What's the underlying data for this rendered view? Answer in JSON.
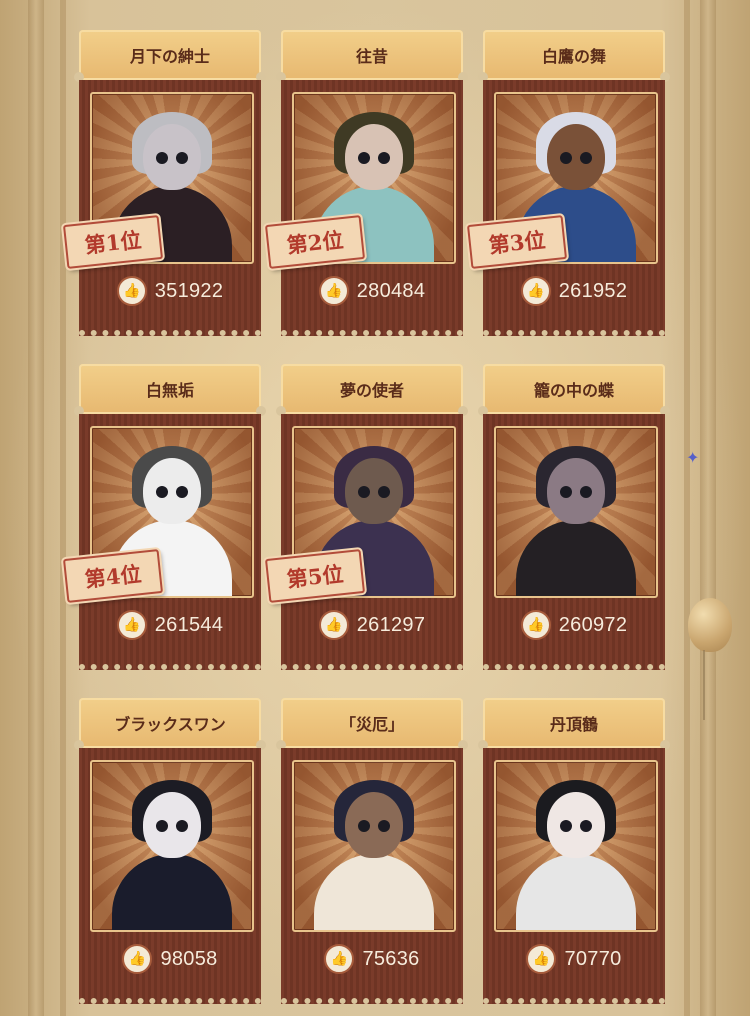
{
  "cards": [
    {
      "name": "月下の紳士",
      "likes": "351922",
      "rank": "第1位",
      "palette": {
        "skin": "#c8c2c8",
        "hair": "#bdbdc2",
        "outfit": "#2b1f24",
        "accent": "#8b1e24"
      }
    },
    {
      "name": "往昔",
      "likes": "280484",
      "rank": "第2位",
      "palette": {
        "skin": "#d8c2b4",
        "hair": "#3f3a24",
        "outfit": "#8dc2c0",
        "accent": "#f2efe6"
      }
    },
    {
      "name": "白鷹の舞",
      "likes": "261952",
      "rank": "第3位",
      "palette": {
        "skin": "#7a5138",
        "hair": "#d9dbe6",
        "outfit": "#2d4d8a",
        "accent": "#f0f0f4"
      }
    },
    {
      "name": "白無垢",
      "likes": "261544",
      "rank": "第4位",
      "palette": {
        "skin": "#ececec",
        "hair": "#4a4a4a",
        "outfit": "#f4f4f4",
        "accent": "#e6c878"
      }
    },
    {
      "name": "夢の使者",
      "likes": "261297",
      "rank": "第5位",
      "palette": {
        "skin": "#6e5a4e",
        "hair": "#3a2b44",
        "outfit": "#3c3150",
        "accent": "#c8a254"
      }
    },
    {
      "name": "籠の中の蝶",
      "likes": "260972",
      "rank": "",
      "palette": {
        "skin": "#8b7a84",
        "hair": "#2a2630",
        "outfit": "#242024",
        "accent": "#a73ea8"
      }
    },
    {
      "name": "ブラックスワン",
      "likes": "98058",
      "rank": "",
      "palette": {
        "skin": "#e9e6ea",
        "hair": "#1c1c24",
        "outfit": "#1a1c2c",
        "accent": "#b3242a"
      }
    },
    {
      "name": "「災厄」",
      "likes": "75636",
      "rank": "",
      "palette": {
        "skin": "#8a6a56",
        "hair": "#25263a",
        "outfit": "#efe6d8",
        "accent": "#3a7b8c"
      }
    },
    {
      "name": "丹頂鶴",
      "likes": "70770",
      "rank": "",
      "palette": {
        "skin": "#efe7e4",
        "hair": "#1b1b1f",
        "outfit": "#e6e6e6",
        "accent": "#9b2a2a"
      }
    }
  ],
  "icons": {
    "like": "thumbs-up-icon",
    "balloon": "balloon-icon",
    "butterfly": "butterfly-icon"
  }
}
